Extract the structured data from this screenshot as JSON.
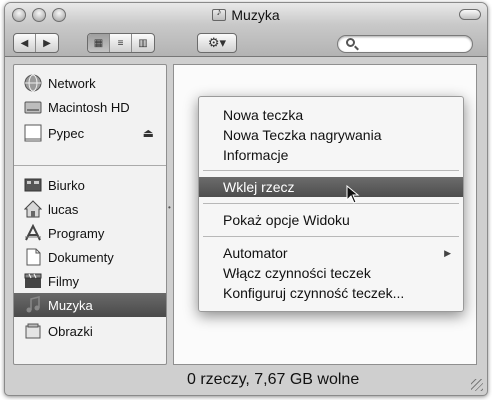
{
  "window": {
    "title": "Muzyka"
  },
  "toolbar": {
    "back_label": "◀",
    "forward_label": "▶",
    "view_icons_label": "▦",
    "view_list_label": "≡",
    "view_columns_label": "▥",
    "action_label": "⚙▾",
    "search": {
      "value": "",
      "placeholder": ""
    }
  },
  "sidebar": {
    "devices": [
      {
        "label": "Network",
        "icon": "network-icon"
      },
      {
        "label": "Macintosh HD",
        "icon": "hard-drive-icon"
      },
      {
        "label": "Pypec",
        "icon": "disk-icon",
        "eject": "⏏"
      }
    ],
    "places": [
      {
        "label": "Biurko",
        "icon": "desktop-icon"
      },
      {
        "label": "lucas",
        "icon": "home-icon"
      },
      {
        "label": "Programy",
        "icon": "applications-icon"
      },
      {
        "label": "Dokumenty",
        "icon": "documents-icon"
      },
      {
        "label": "Filmy",
        "icon": "movies-icon"
      },
      {
        "label": "Muzyka",
        "icon": "music-icon",
        "selected": true
      },
      {
        "label": "Obrazki",
        "icon": "pictures-icon"
      }
    ]
  },
  "context_menu": {
    "group1": [
      "Nowa teczka",
      "Nowa Teczka nagrywania",
      "Informacje"
    ],
    "group2": [
      "Wklej rzecz"
    ],
    "group3": [
      "Pokaż opcje Widoku"
    ],
    "group4": [
      "Automator",
      "Włącz czynności teczek",
      "Konfiguruj czynność teczek..."
    ],
    "highlighted": "Wklej rzecz",
    "submenu_arrow": "▶"
  },
  "status": {
    "text": "0 rzeczy, 7,67 GB wolne"
  },
  "colors": {
    "highlight": "#5a5a5a",
    "sidebar_bg": "#f2f2f2"
  }
}
